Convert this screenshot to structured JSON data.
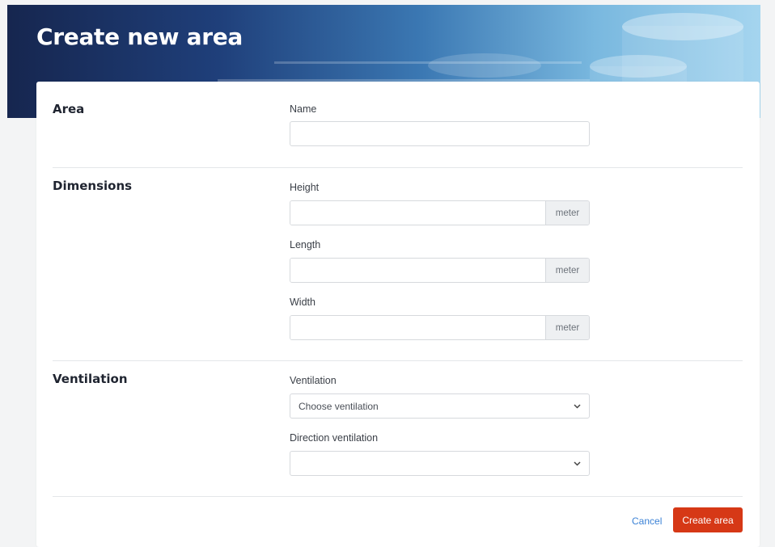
{
  "header": {
    "title": "Create new area"
  },
  "sections": {
    "area": {
      "title": "Area",
      "name_label": "Name",
      "name_value": ""
    },
    "dimensions": {
      "title": "Dimensions",
      "height_label": "Height",
      "height_value": "",
      "height_unit": "meter",
      "length_label": "Length",
      "length_value": "",
      "length_unit": "meter",
      "width_label": "Width",
      "width_value": "",
      "width_unit": "meter"
    },
    "ventilation": {
      "title": "Ventilation",
      "ventilation_label": "Ventilation",
      "ventilation_selected": "Choose ventilation",
      "direction_label": "Direction ventilation",
      "direction_selected": ""
    }
  },
  "actions": {
    "cancel_label": "Cancel",
    "submit_label": "Create area"
  },
  "colors": {
    "primary_button": "#d63816",
    "link": "#3b82d6",
    "hero_dark": "#16264f",
    "hero_light": "#a5d5ef"
  },
  "icons": {
    "select_chevron": "chevron-down-icon"
  }
}
